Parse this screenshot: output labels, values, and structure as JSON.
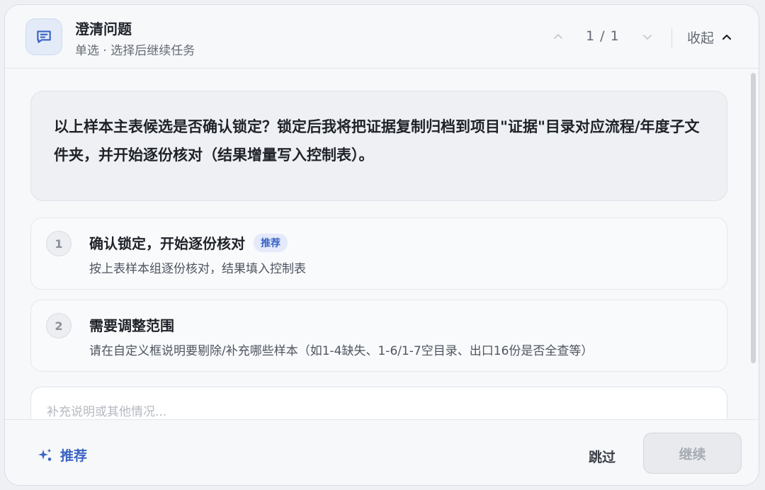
{
  "header": {
    "title": "澄清问题",
    "subtitle": "单选 · 选择后继续任务",
    "pager": "1 / 1",
    "collapse_label": "收起"
  },
  "question": {
    "text": "以上样本主表候选是否确认锁定？锁定后我将把证据复制归档到项目\"证据\"目录对应流程/年度子文件夹，并开始逐份核对（结果增量写入控制表）。"
  },
  "options": [
    {
      "number": "1",
      "title": "确认锁定，开始逐份核对",
      "badge": "推荐",
      "description": "按上表样本组逐份核对，结果填入控制表"
    },
    {
      "number": "2",
      "title": "需要调整范围",
      "description": "请在自定义框说明要剔除/补充哪些样本（如1-4缺失、1-6/1-7空目录、出口16份是否全查等）"
    }
  ],
  "custom_input": {
    "placeholder": "补充说明或其他情况..."
  },
  "footer": {
    "recommend_label": "推荐",
    "skip_label": "跳过",
    "continue_label": "继续"
  },
  "icons": {
    "header": "chat-bubble-icon",
    "up": "chevron-up-icon",
    "down": "chevron-down-icon",
    "collapse": "chevron-up-icon",
    "recommend": "sparkle-icon"
  },
  "colors": {
    "accent": "#3c64c4",
    "background": "#f7f8fa",
    "disabled_button": "#e8eaee"
  }
}
